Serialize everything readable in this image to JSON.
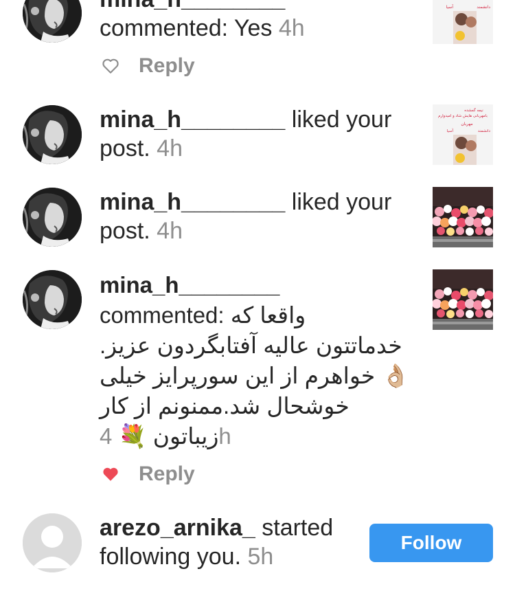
{
  "notifications": [
    {
      "username": "mina_h________",
      "action": "commented: Yes",
      "time": "4h",
      "reply_label": "Reply",
      "liked": false
    },
    {
      "username": "mina_h________",
      "action": " liked your post.",
      "time": "4h"
    },
    {
      "username": "mina_h________",
      "action": " liked your post.",
      "time": "4h"
    },
    {
      "username": "mina_h________",
      "action_prefix": "commented:",
      "comment_lines": [
        "واقعا که",
        "خدماتتون عالیه آفتابگردون عزیز.",
        "👌🏼 خواهرم از این سورپرایز خیلی",
        "خوشحال شد.ممنونم از کار",
        "زیباتون 💐"
      ],
      "time_prefix": "4",
      "time_suffix": "h",
      "reply_label": "Reply",
      "liked": true
    },
    {
      "username": "arezo_arnika_",
      "action": " started following you.",
      "time": "5h",
      "follow_label": "Follow"
    }
  ],
  "thumb_text": {
    "line1": "نیمه گمشده",
    "line2": "بامهربانی‌ هایش شاد و امیدوارم",
    "line3": "مهربان",
    "line4": "دانشمند",
    "line5": "آسیا"
  },
  "colors": {
    "accent": "#3897f0",
    "liked_heart": "#ed4956",
    "muted": "#8e8e8e"
  }
}
